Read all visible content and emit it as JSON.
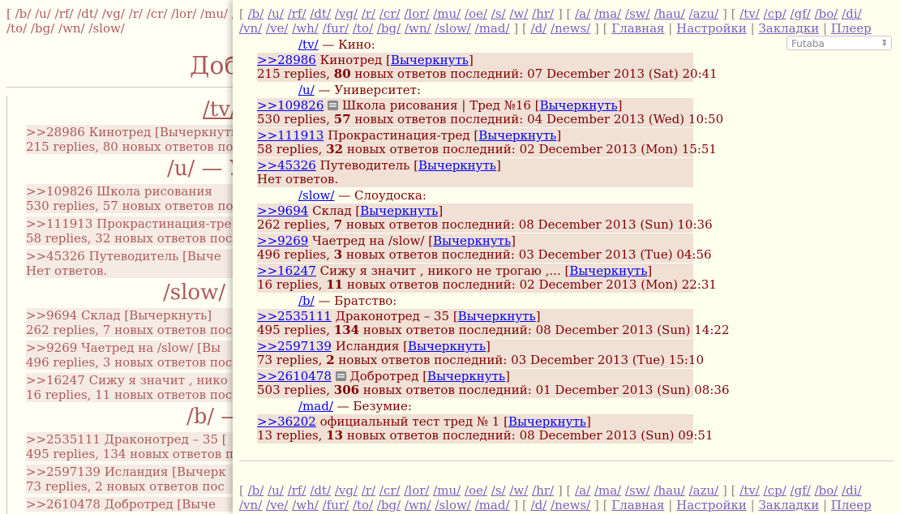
{
  "background": {
    "nav_text": "[ /b/ /u/ /rf/ /dt/ /vg/ /r/ /cr/ /lor/ /mu/ /vn/ /ve/ /wh/ /fur/ /to/ /bg/ /wn/ /slow/",
    "title": "Доб",
    "heads": [
      "/tv/",
      "/u/ — У",
      "/slow/ —",
      "/b/ —"
    ],
    "blocks": [
      {
        "l1": ">>28986 Кинотред [Вычеркнуть",
        "l2": "215 replies, 80 новых ответов по"
      },
      {
        "l1": ">>109826 Школа рисования",
        "l2": "530 replies, 57 новых ответов по"
      },
      {
        "l1": ">>111913 Прокрастинация-тре",
        "l2": "58 replies, 32 новых ответов пос"
      },
      {
        "l1": ">>45326 Путеводитель [Выче",
        "l2": "Нет ответов."
      },
      {
        "l1": ">>9694 Склад [Вычеркнуть]",
        "l2": "262 replies, 7 новых ответов пос"
      },
      {
        "l1": ">>9269 Чаетред на /slow/ [Вы",
        "l2": "496 replies, 3 новых ответов пос"
      },
      {
        "l1": ">>16247 Сижу я значит , нико",
        "l2": "16 replies, 11 новых ответов пос"
      },
      {
        "l1": ">>2535111 Драконотред – 35 [",
        "l2": "495 replies, 134 новых ответов п"
      },
      {
        "l1": ">>2597139 Исландия [Вычерк",
        "l2": "73 replies, 2 новых ответов пос"
      },
      {
        "l1": ">>2610478 Добротред [Выче",
        "l2": ""
      }
    ]
  },
  "nav": {
    "line1": {
      "group1": [
        "/b/",
        "/u/",
        "/rf/",
        "/dt/",
        "/vg/",
        "/r/",
        "/cr/",
        "/lor/",
        "/mu/",
        "/oe/",
        "/s/",
        "/w/",
        "/hr/"
      ],
      "group2": [
        "/a/",
        "/ma/",
        "/sw/",
        "/hau/",
        "/azu/"
      ],
      "group3": [
        "/tv/",
        "/cp/",
        "/gf/",
        "/bo/",
        "/di/"
      ]
    },
    "line2": {
      "group3b": [
        "/vn/",
        "/ve/",
        "/wh/",
        "/fur/",
        "/to/",
        "/bg/",
        "/wn/",
        "/slow/",
        "/mad/"
      ],
      "group4": [
        "/d/",
        "/news/"
      ],
      "group5": [
        "Главная",
        "Настройки",
        "Закладки",
        "Плеер"
      ]
    }
  },
  "style_select": {
    "value": "Futaba"
  },
  "strike_label": "Вычеркнуть",
  "replies_word": "replies,",
  "new_words": "новых ответов последний:",
  "no_replies": "Нет ответов.",
  "boards": [
    {
      "name": "/tv/",
      "desc": "— Кино:",
      "threads": [
        {
          "id": ">>28986",
          "title": "Кинотред",
          "pin": false,
          "replies": "215",
          "new": "80",
          "date": "07 December 2013 (Sat) 20:41"
        }
      ]
    },
    {
      "name": "/u/",
      "desc": "— Университет:",
      "threads": [
        {
          "id": ">>109826",
          "title": "Школа рисования | Тред №16",
          "pin": true,
          "replies": "530",
          "new": "57",
          "date": "04 December 2013 (Wed) 10:50"
        },
        {
          "id": ">>111913",
          "title": "Прокрастинация-тред",
          "pin": false,
          "replies": "58",
          "new": "32",
          "date": "02 December 2013 (Mon) 15:51"
        },
        {
          "id": ">>45326",
          "title": "Путеводитель",
          "pin": false,
          "replies": "",
          "new": "",
          "date": ""
        }
      ]
    },
    {
      "name": "/slow/",
      "desc": "— Слоудоска:",
      "threads": [
        {
          "id": ">>9694",
          "title": "Склад",
          "pin": false,
          "replies": "262",
          "new": "7",
          "date": "08 December 2013 (Sun) 10:36"
        },
        {
          "id": ">>9269",
          "title": "Чаетред на /slow/",
          "pin": false,
          "replies": "496",
          "new": "3",
          "date": "03 December 2013 (Tue) 04:56"
        },
        {
          "id": ">>16247",
          "title": "Сижу я значит , никого не трогаю ,...",
          "pin": false,
          "replies": "16",
          "new": "11",
          "date": "02 December 2013 (Mon) 22:31"
        }
      ]
    },
    {
      "name": "/b/",
      "desc": "— Братство:",
      "threads": [
        {
          "id": ">>2535111",
          "title": "Драконотред – 35",
          "pin": false,
          "replies": "495",
          "new": "134",
          "date": "08 December 2013 (Sun) 14:22"
        },
        {
          "id": ">>2597139",
          "title": "Исландия",
          "pin": false,
          "replies": "73",
          "new": "2",
          "date": "03 December 2013 (Tue) 15:10"
        },
        {
          "id": ">>2610478",
          "title": "Добротред",
          "pin": true,
          "replies": "503",
          "new": "306",
          "date": "01 December 2013 (Sun) 08:36"
        }
      ]
    },
    {
      "name": "/mad/",
      "desc": "— Безумие:",
      "threads": [
        {
          "id": ">>36202",
          "title": "официальный тест тред № 1",
          "pin": false,
          "replies": "13",
          "new": "13",
          "date": "08 December 2013 (Sun) 09:51"
        }
      ]
    }
  ]
}
